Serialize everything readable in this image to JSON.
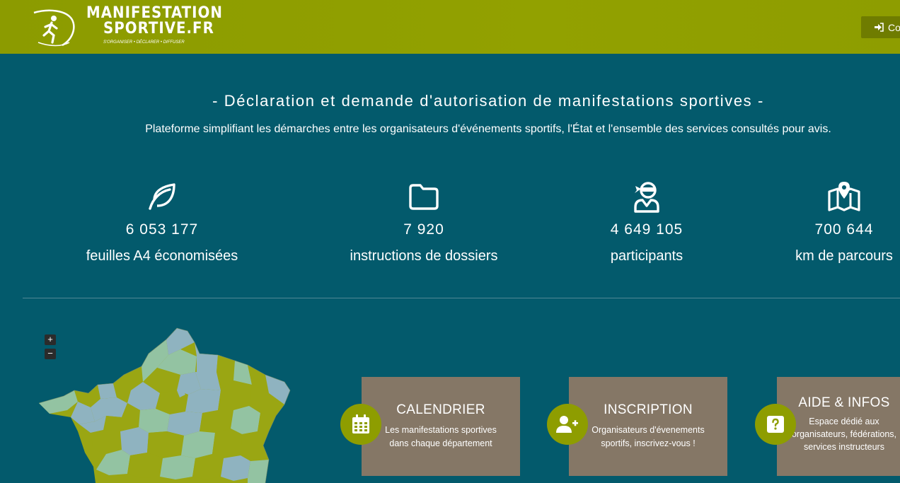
{
  "header": {
    "logo_line1": "MANIFESTATION",
    "logo_line2": "SPORTIVE.FR",
    "logo_tagline": "S'ORGANISER • DÉCLARER • DIFFUSER",
    "login_label": "Co"
  },
  "hero": {
    "title": "- Déclaration et demande d'autorisation de manifestations sportives -",
    "subtitle": "Plateforme simplifiant les démarches entre les organisateurs d'événements sportifs, l'État et l'ensemble des services consultés pour avis."
  },
  "stats": [
    {
      "icon": "leaf-icon",
      "value": "6 053 177",
      "label": "feuilles A4 économisées"
    },
    {
      "icon": "folder-icon",
      "value": "7 920",
      "label": "instructions de dossiers"
    },
    {
      "icon": "user-ninja-icon",
      "value": "4 649 105",
      "label": "participants"
    },
    {
      "icon": "map-marked-icon",
      "value": "700 644",
      "label": "km de parcours"
    }
  ],
  "map": {
    "zoom_in": "+",
    "zoom_out": "−"
  },
  "cards": [
    {
      "icon": "calendar-icon",
      "title": "CALENDRIER",
      "desc": "Les manifestations sportives dans chaque département"
    },
    {
      "icon": "user-plus-icon",
      "title": "INSCRIPTION",
      "desc": "Organisateurs d'évenements sportifs, inscrivez-vous !"
    },
    {
      "icon": "question-icon",
      "title": "AIDE & INFOS",
      "desc": "Espace dédié aux organisateurs, fédérations, services instructeurs"
    }
  ],
  "colors": {
    "header": "#8c9b00",
    "background": "#035a6c",
    "card": "#857766",
    "accent": "#8e9d00",
    "map_olive": "#9aa613",
    "map_blue": "#8fb3c0",
    "map_green": "#93c3a2"
  }
}
